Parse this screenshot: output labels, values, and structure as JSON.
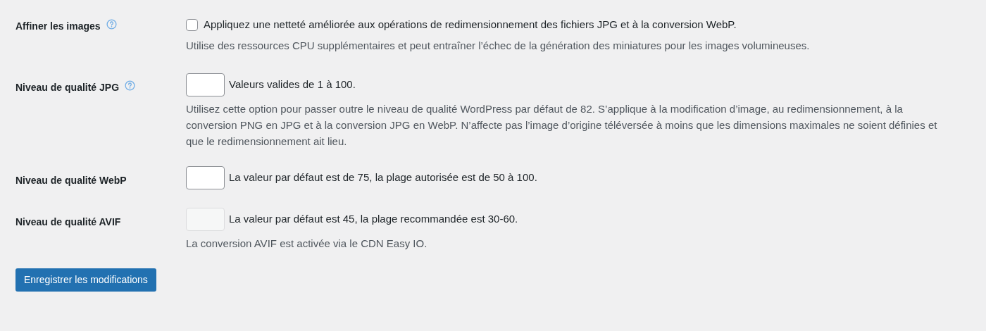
{
  "settings": [
    {
      "kind": "checkbox",
      "label": "Affiner les images",
      "help": true,
      "checked": false,
      "inline": "Appliquez une netteté améliorée aux opérations de redimensionnement des fichiers JPG et à la conversion WebP.",
      "description": "Utilise des ressources CPU supplémentaires et peut entraîner l’échec de la génération des miniatures pour les images volumineuses."
    },
    {
      "kind": "number",
      "label": "Niveau de qualité JPG",
      "help": true,
      "disabled": false,
      "inline": "Valeurs valides de 1 à 100.",
      "description": "Utilisez cette option pour passer outre le niveau de qualité WordPress par défaut de 82. S’applique à la modification d’image, au redimensionnement, à la conversion PNG en JPG et à la conversion JPG en WebP. N’affecte pas l’image d’origine téléversée à moins que les dimensions maximales ne soient définies et que le redimensionnement ait lieu."
    },
    {
      "kind": "number",
      "label": "Niveau de qualité WebP",
      "help": false,
      "disabled": false,
      "inline": "La valeur par défaut est de 75, la plage autorisée est de 50 à 100."
    },
    {
      "kind": "number",
      "label": "Niveau de qualité AVIF",
      "help": false,
      "disabled": true,
      "inline": "La valeur par défaut est 45, la plage recommandée est 30-60.",
      "description": "La conversion AVIF est activée via le CDN Easy IO."
    }
  ],
  "save_button": "Enregistrer les modifications"
}
